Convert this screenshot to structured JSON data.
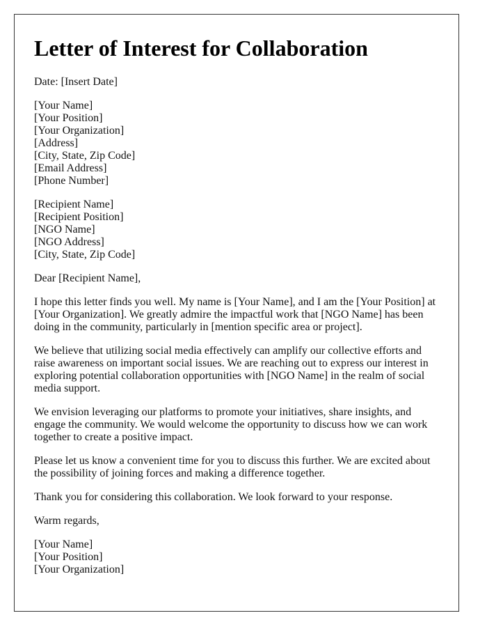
{
  "title": "Letter of Interest for Collaboration",
  "date_line": "Date: [Insert Date]",
  "sender": [
    "[Your Name]",
    "[Your Position]",
    "[Your Organization]",
    "[Address]",
    "[City, State, Zip Code]",
    "[Email Address]",
    "[Phone Number]"
  ],
  "recipient": [
    "[Recipient Name]",
    "[Recipient Position]",
    "[NGO Name]",
    "[NGO Address]",
    "[City, State, Zip Code]"
  ],
  "salutation": "Dear [Recipient Name],",
  "paragraphs": [
    "I hope this letter finds you well. My name is [Your Name], and I am the [Your Position] at [Your Organization]. We greatly admire the impactful work that [NGO Name] has been doing in the community, particularly in [mention specific area or project].",
    "We believe that utilizing social media effectively can amplify our collective efforts and raise awareness on important social issues. We are reaching out to express our interest in exploring potential collaboration opportunities with [NGO Name] in the realm of social media support.",
    "We envision leveraging our platforms to promote your initiatives, share insights, and engage the community. We would welcome the opportunity to discuss how we can work together to create a positive impact.",
    "Please let us know a convenient time for you to discuss this further. We are excited about the possibility of joining forces and making a difference together.",
    "Thank you for considering this collaboration. We look forward to your response."
  ],
  "closing": "Warm regards,",
  "signature": [
    "[Your Name]",
    "[Your Position]",
    "[Your Organization]"
  ]
}
